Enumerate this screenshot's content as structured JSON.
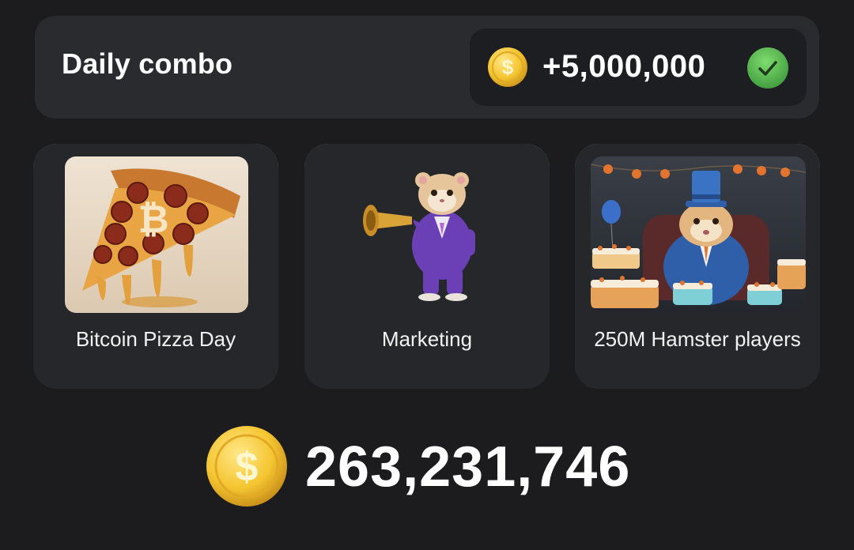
{
  "daily_combo": {
    "title": "Daily combo",
    "reward": "+5,000,000",
    "status_icon": "check-icon",
    "status_color": "#4caf50"
  },
  "cards": [
    {
      "label": "Bitcoin Pizza Day",
      "image": "bitcoin-pizza-image"
    },
    {
      "label": "Marketing",
      "image": "hamster-trumpet-image"
    },
    {
      "label": "250M Hamster players",
      "image": "hamster-party-image"
    }
  ],
  "balance": {
    "value": "263,231,746",
    "icon": "coin-icon"
  },
  "colors": {
    "background": "#1c1c1e",
    "card": "#26272b",
    "card_border_accent": "#6fcf62",
    "coin": "#f5c531"
  }
}
